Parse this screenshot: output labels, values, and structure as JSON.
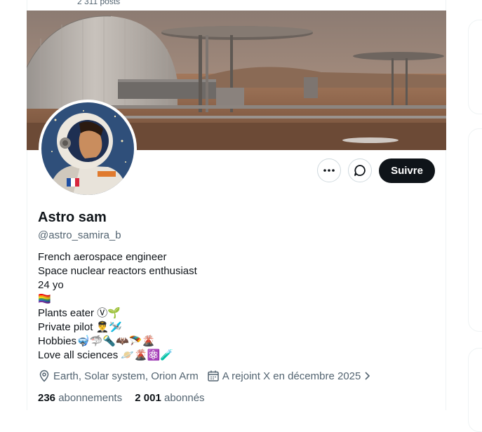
{
  "header": {
    "post_count": "2 311 posts"
  },
  "profile": {
    "name": "Astro sam",
    "handle": "@astro_samira_b",
    "follow_label": "Suivre",
    "bio_lines": [
      "French aerospace engineer",
      "Space nuclear reactors enthusiast",
      "24 yo",
      "🏳️‍🌈",
      "Plants eater Ⓥ🌱",
      "Private pilot 👨‍✈️🛩️",
      "Hobbies🤿🦈🔦🦇🪂🌋",
      "Love all sciences 🪐🌋⚛️🧪"
    ],
    "location": "Earth, Solar system, Orion Arm",
    "joined": "A rejoint X en décembre 2025",
    "following_count": "236",
    "following_label": "abonnements",
    "followers_count": "2 001",
    "followers_label": "abonnés"
  },
  "icons": {
    "more": "more-icon",
    "message": "message-icon",
    "location": "location-icon",
    "calendar": "calendar-icon"
  },
  "colors": {
    "follow_bg": "#0f1419",
    "secondary_text": "#536471",
    "border": "#cfd9de"
  }
}
